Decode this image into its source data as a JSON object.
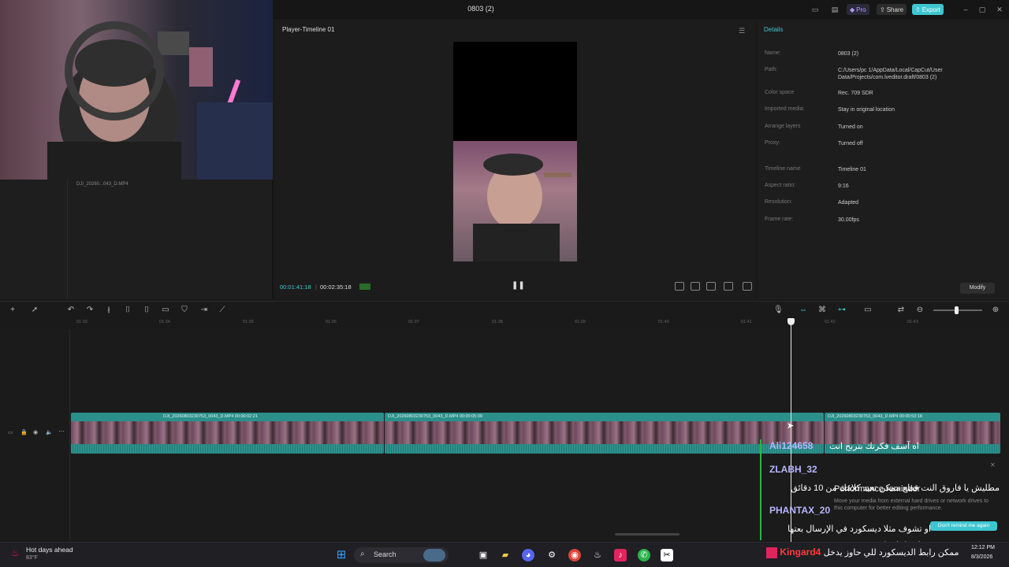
{
  "window": {
    "title": "0803 (2)",
    "pro_label": "Pro",
    "share_label": "Share",
    "export_label": "Export",
    "accent": "#3ec6d0"
  },
  "media_panel": {
    "media_name": "DJI_20260...043_D.MP4"
  },
  "player": {
    "title": "Player-Timeline 01",
    "current_time": "00:01:41:18",
    "total_time": "00:02:35:18"
  },
  "details": {
    "tab_label": "Details",
    "rows": [
      {
        "key": "Name:",
        "value": "0803 (2)"
      },
      {
        "key": "Path:",
        "value": "C:/Users/pc 1/AppData/Local/CapCut/User Data/Projects/com.lveditor.draft/0803 (2)"
      },
      {
        "key": "Color space",
        "value": "Rec. 709 SDR"
      },
      {
        "key": "Imported media:",
        "value": "Stay in original location"
      },
      {
        "key": "Arrange layers",
        "value": "Turned on"
      },
      {
        "key": "Proxy:",
        "value": "Turned off"
      },
      {
        "key": "Timeline name",
        "value": "Timeline 01"
      },
      {
        "key": "Aspect ratio:",
        "value": "9:16"
      },
      {
        "key": "Resolution:",
        "value": "Adapted"
      },
      {
        "key": "Frame rate:",
        "value": "30.00fps"
      }
    ],
    "modify_label": "Modify"
  },
  "ruler": {
    "ticks": [
      "01:33",
      "01:34",
      "01:35",
      "01:36",
      "01:37",
      "01:38",
      "01:39",
      "01:40",
      "01:41",
      "01:42",
      "01:43"
    ]
  },
  "clips": [
    {
      "label": "DJI_20260803230753_0043_D.MP4   00:00:02:21"
    },
    {
      "label": "DJI_20260803230753_0043_D.MP4   00:00:05:09"
    },
    {
      "label": "DJI_20260803230753_0043_D.MP4   00:00:53:18"
    }
  ],
  "chat": [
    {
      "user": "Ali124658",
      "message": "اه آسف فكرتك بتربح انت"
    },
    {
      "user": "ZLABH_32",
      "message": "مطليش يا فاروق النت قطع ممكن تعيد كلامك من 10 دقائق"
    },
    {
      "user": "PHANTAX_20",
      "message": "او تشوف مثلا ديسكورد في الإرسال بعتها نشاهد احلى انمي"
    },
    {
      "user": "Kingard4",
      "message": "ممكن رابط الديسكورد للي حاوز يدخل"
    }
  ],
  "performance": {
    "title": "Performance reminder",
    "subtitle": "Move your media from external hard drives or network drives to this computer for better editing performance.",
    "button": "Don't remind me again"
  },
  "taskbar": {
    "weather_title": "Hot days ahead",
    "weather_temp": "83°F",
    "search_label": "Search",
    "time": "12:12 PM",
    "date": "8/3/2026"
  }
}
